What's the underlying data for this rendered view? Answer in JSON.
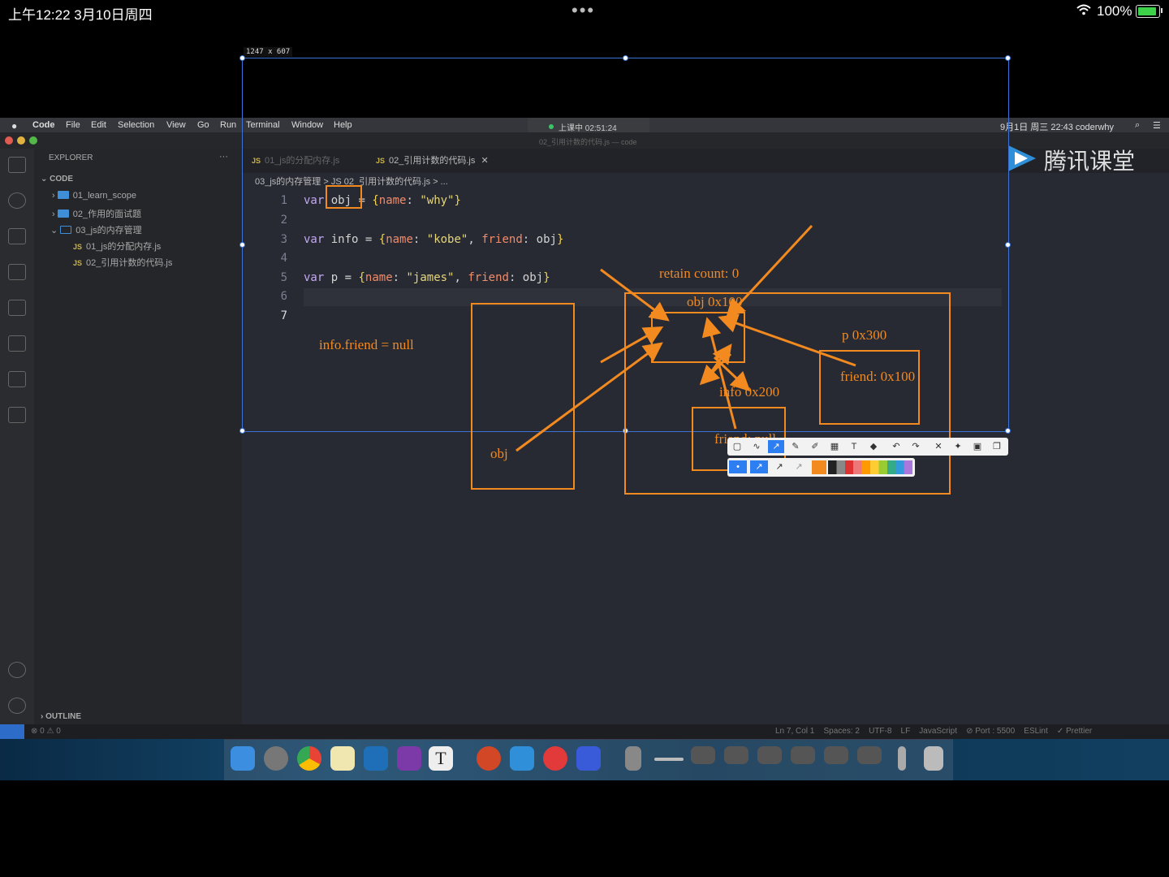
{
  "ipad_status": {
    "time": "上午12:22   3月10日周四",
    "dots": "•••",
    "battery": "100%"
  },
  "mac_menu": {
    "items": [
      "Code",
      "File",
      "Edit",
      "Selection",
      "View",
      "Go",
      "Run",
      "Terminal",
      "Window",
      "Help"
    ],
    "live": "上课中 02:51:24",
    "right": "9月1日 周三  22:43   coderwhy"
  },
  "window_title": "02_引用计数的代码.js — code",
  "sidebar": {
    "title": "EXPLORER",
    "section": "CODE",
    "items": [
      "01_learn_scope",
      "02_作用的面试题",
      "03_js的内存管理"
    ],
    "files": [
      "01_js的分配内存.js",
      "02_引用计数的代码.js"
    ],
    "outline": "OUTLINE"
  },
  "tabs": [
    "01_js的分配内存.js",
    "02_引用计数的代码.js"
  ],
  "breadcrumb": "03_js的内存管理 > JS 02_引用计数的代码.js > ...",
  "code_lines": [
    "1",
    "2",
    "3",
    "4",
    "5",
    "6",
    "7"
  ],
  "logo": "腾讯课堂",
  "selection_size": "1247 x 607",
  "annotations": {
    "retain": "retain count: 0",
    "obj_addr": "obj 0x100",
    "p_addr": "p 0x300",
    "p_friend": "friend: 0x100",
    "info_addr": "info 0x200",
    "info_friend": "friend: null",
    "statement": "info.friend = null",
    "obj": "obj"
  },
  "status": {
    "left": "⊗ 0 ⚠ 0",
    "right": "Ln 7, Col 1    Spaces: 2    UTF-8    LF    JavaScript    ⊘ Port : 5500    ESLint    ✓ Prettier"
  },
  "colors": {
    "accent": "#f28a1f",
    "selection": "#3b73d6",
    "editor_bg": "#282a33"
  }
}
